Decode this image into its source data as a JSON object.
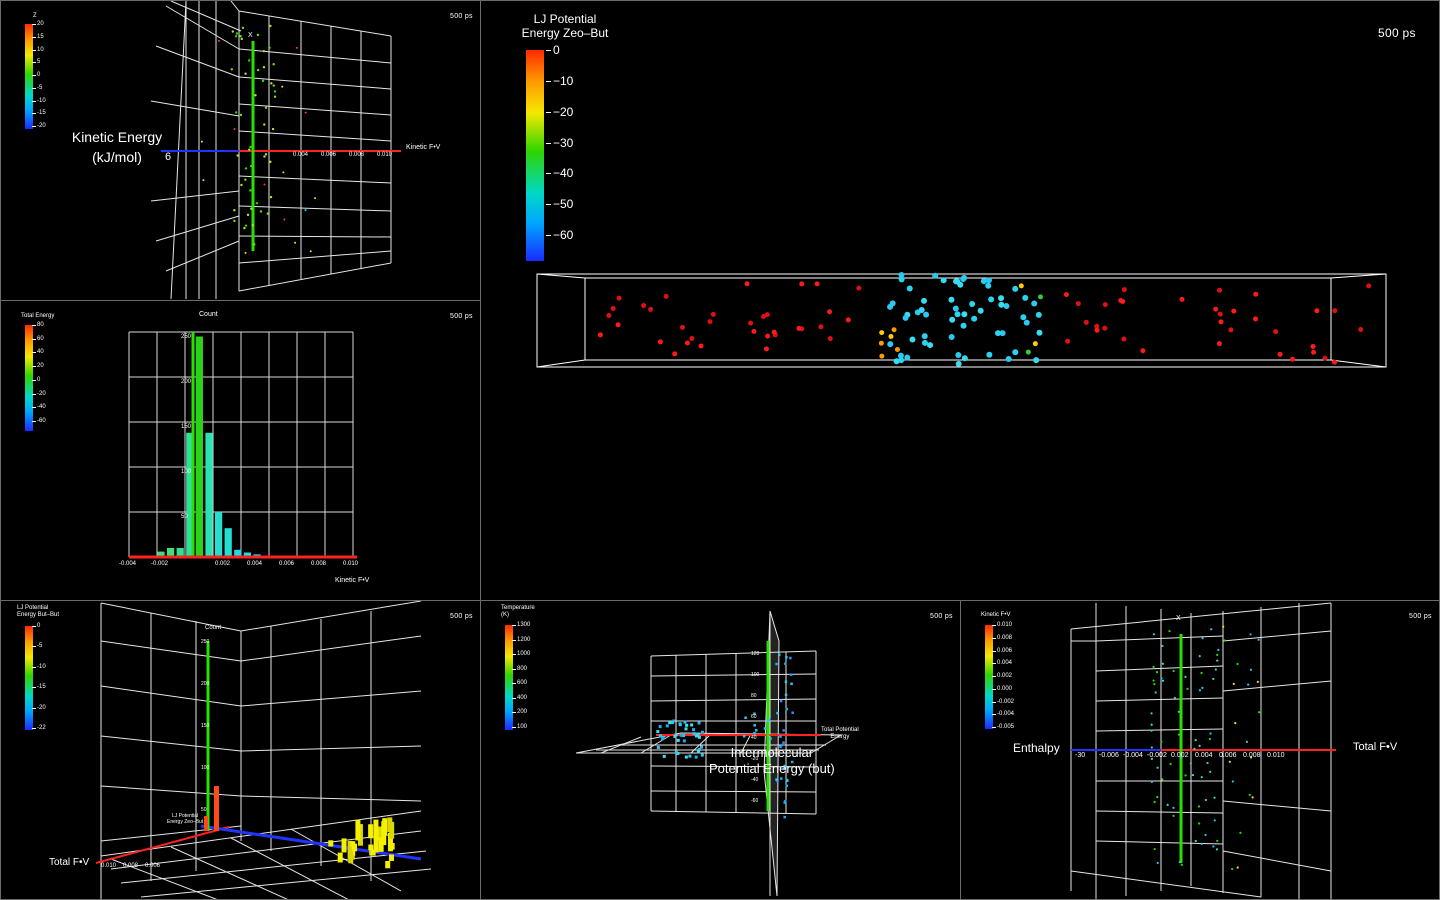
{
  "time": "500 ps",
  "panels": {
    "top_left": {
      "legend_title": "Z",
      "legend_ticks": [
        "20",
        "15",
        "10",
        "5",
        "0",
        "-5",
        "-10",
        "-15",
        "-20"
      ],
      "y_axis_title": "Kinetic  Energy\n(kJ/mol)",
      "y_axis_tick_partial": "6",
      "x_axis_title": "Kinetic  F•V",
      "x_ticks": [
        "0.004",
        "0.006",
        "0.008",
        "0.010"
      ],
      "top_label": "X"
    },
    "mid_left": {
      "legend_title": "Total  Energy",
      "legend_ticks": [
        "80",
        "60",
        "40",
        "20",
        "0",
        "-20",
        "-40",
        "-60"
      ],
      "y_title": "Count",
      "y_ticks": [
        "250",
        "200",
        "150",
        "100",
        "50"
      ],
      "x_ticks": [
        "-0.004",
        "-0.002",
        "0.002",
        "0.004",
        "0.006",
        "0.008",
        "0.010"
      ],
      "x_title": "Kinetic  F•V",
      "chart_data": {
        "type": "bar",
        "title": "",
        "xlabel": "Kinetic  F•V",
        "ylabel": "Count",
        "xlim": [
          -0.004,
          0.01
        ],
        "ylim": [
          0,
          250
        ],
        "bins": [
          -0.0032,
          -0.0026,
          -0.002,
          -0.0014,
          -0.0008,
          -0.0002,
          0.0004,
          0.001,
          0.0016,
          0.0022,
          0.0028,
          0.0034,
          0.004
        ],
        "counts": [
          1,
          1,
          6,
          10,
          10,
          138,
          245,
          138,
          50,
          32,
          8,
          5,
          3
        ],
        "colors": [
          "#3fe07a",
          "#3fe07a",
          "#3fe07a",
          "#3fe07a",
          "#2fe090",
          "#2fe09b",
          "#2bd21c",
          "#29e3b3",
          "#23dfd0",
          "#23dfd0",
          "#23d8ea",
          "#23d8ea",
          "#23c8f0"
        ]
      }
    },
    "main": {
      "legend_title": "LJ  Potential\nEnergy  Zeo–But",
      "legend_ticks": [
        "0",
        "−10",
        "−20",
        "−30",
        "−40",
        "−50",
        "−60"
      ]
    },
    "bottom_left": {
      "legend_title": "LJ  Potential\nEnergy  But–But",
      "legend_ticks": [
        "0",
        "-5",
        "-10",
        "-15",
        "-20",
        "-22"
      ],
      "count_title": "Count",
      "count_ticks": [
        "250",
        "200",
        "150",
        "100",
        "50"
      ],
      "x_title": "Total  F•V",
      "x_ticks": [
        "0.010",
        "0.008",
        "0.006"
      ],
      "mini_label": "LJ  Potential\nEnergy  Zeo–But"
    },
    "bottom_mid": {
      "legend_title": "Temperature\n(K)",
      "legend_ticks": [
        "1300",
        "1200",
        "1000",
        "800",
        "600",
        "400",
        "200",
        "100"
      ],
      "axis_label_plane": "Total  Potential\nEnergy",
      "axis_title": "Intermolecular\nPotential  Energy  (but)",
      "y_ticks": [
        "120",
        "100",
        "80",
        "60",
        "40",
        "-20",
        "-40",
        "-60"
      ]
    },
    "bottom_right": {
      "legend_title": "Kinetic  F•V",
      "legend_ticks": [
        "0.010",
        "0.008",
        "0.006",
        "0.004",
        "0.002",
        "0.000",
        "-0.002",
        "-0.004",
        "-0.005"
      ],
      "y_title": "Enthalpy",
      "x_title": "Total  F•V",
      "x_ticks": [
        "-30",
        "-0.006",
        "-0.004",
        "-0.002",
        "0.002",
        "0.004",
        "0.006",
        "0.008",
        "0.010"
      ],
      "top_label": "X"
    }
  }
}
